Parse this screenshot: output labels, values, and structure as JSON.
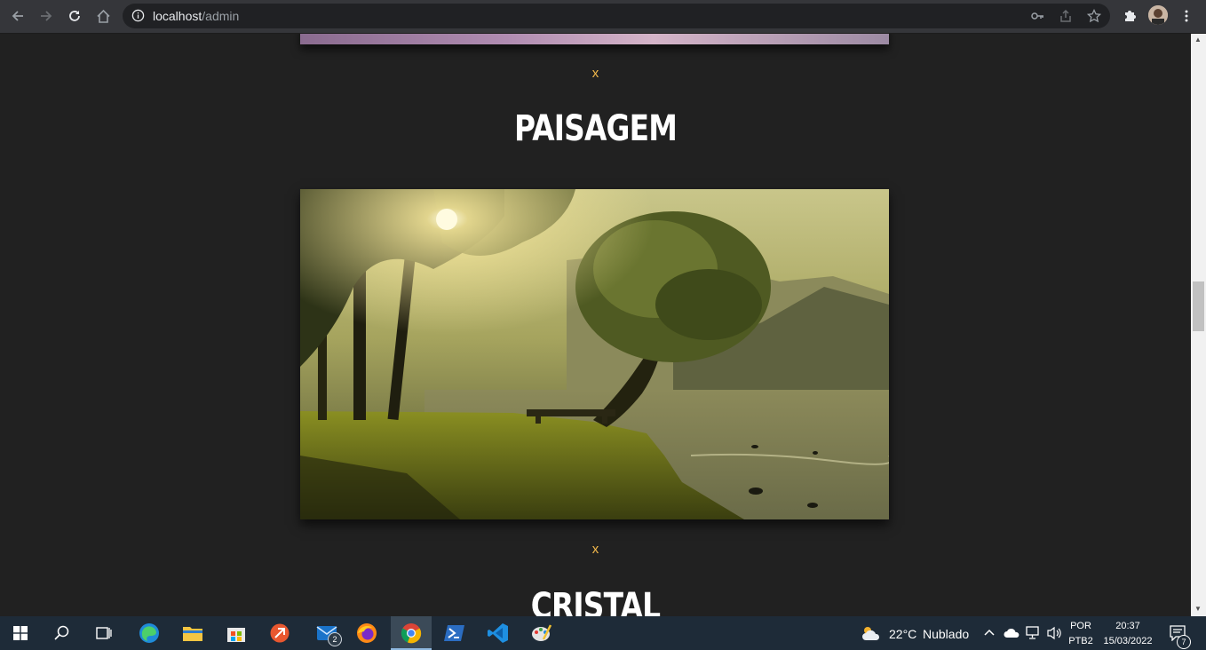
{
  "browser": {
    "url_host": "localhost",
    "url_path": "/admin",
    "nav_icons": [
      "back-arrow-icon",
      "forward-arrow-icon",
      "reload-icon",
      "home-icon"
    ],
    "omnibox_icons": [
      "key-icon",
      "share-icon",
      "star-icon"
    ],
    "toolbar_icons": [
      "puzzle-icon",
      "more-vert-icon"
    ]
  },
  "page": {
    "delete_label_top": "x",
    "section_title": "PAISAGEM",
    "delete_label_bottom": "x",
    "next_section_title": "CRISTAL"
  },
  "taskbar": {
    "apps": [
      "windows-start-icon",
      "search-icon",
      "task-view-icon",
      "edge-icon",
      "file-explorer-icon",
      "microsoft-store-icon",
      "git-icon",
      "mail-icon",
      "firefox-icon",
      "chrome-icon",
      "powershell-icon",
      "vscode-icon",
      "paint-icon"
    ],
    "mail_badge": "2",
    "weather_temp": "22°C",
    "weather_text": "Nublado",
    "lang_top": "POR",
    "lang_bottom": "PTB2",
    "time": "20:37",
    "date": "15/03/2022",
    "notifications_badge": "7"
  },
  "colors": {
    "page_bg": "#212121",
    "accent_x": "#f2b84b",
    "taskbar_bg": "#1e2b38"
  }
}
